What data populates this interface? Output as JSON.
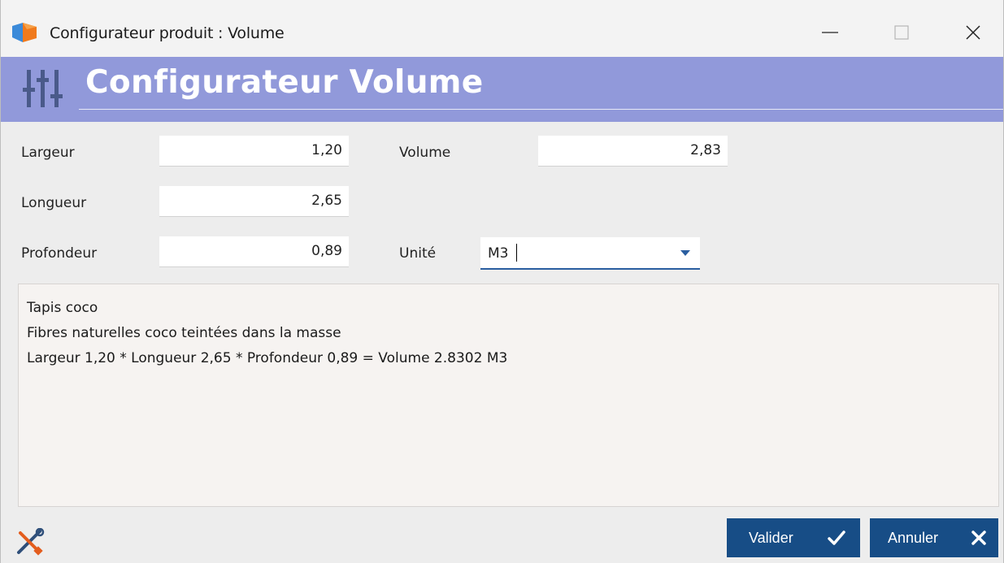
{
  "window": {
    "title": "Configurateur produit : Volume",
    "app_icon": "app-logo-icon",
    "minimize_icon": "minimize-icon",
    "maximize_icon": "maximize-icon",
    "close_icon": "close-icon"
  },
  "header": {
    "icon": "sliders-icon",
    "title": "Configurateur Volume",
    "band_color": "#9199da"
  },
  "form": {
    "largeur": {
      "label": "Largeur",
      "value": "1,20"
    },
    "longueur": {
      "label": "Longueur",
      "value": "2,65"
    },
    "profondeur": {
      "label": "Profondeur",
      "value": "0,89"
    },
    "volume": {
      "label": "Volume",
      "value": "2,83"
    },
    "unite": {
      "label": "Unité",
      "value": "M3",
      "dropdown_icon": "chevron-down-icon"
    }
  },
  "description": {
    "lines": [
      "Tapis coco",
      "Fibres naturelles coco teintées dans la masse",
      "Largeur 1,20 * Longueur 2,65 * Profondeur 0,89 = Volume 2.8302 M3"
    ]
  },
  "footer": {
    "tools_icon": "tools-icon",
    "ok_label": "Valider",
    "ok_icon": "checkmark-icon",
    "cancel_label": "Annuler",
    "cancel_icon": "close-icon",
    "button_color": "#174d86"
  }
}
